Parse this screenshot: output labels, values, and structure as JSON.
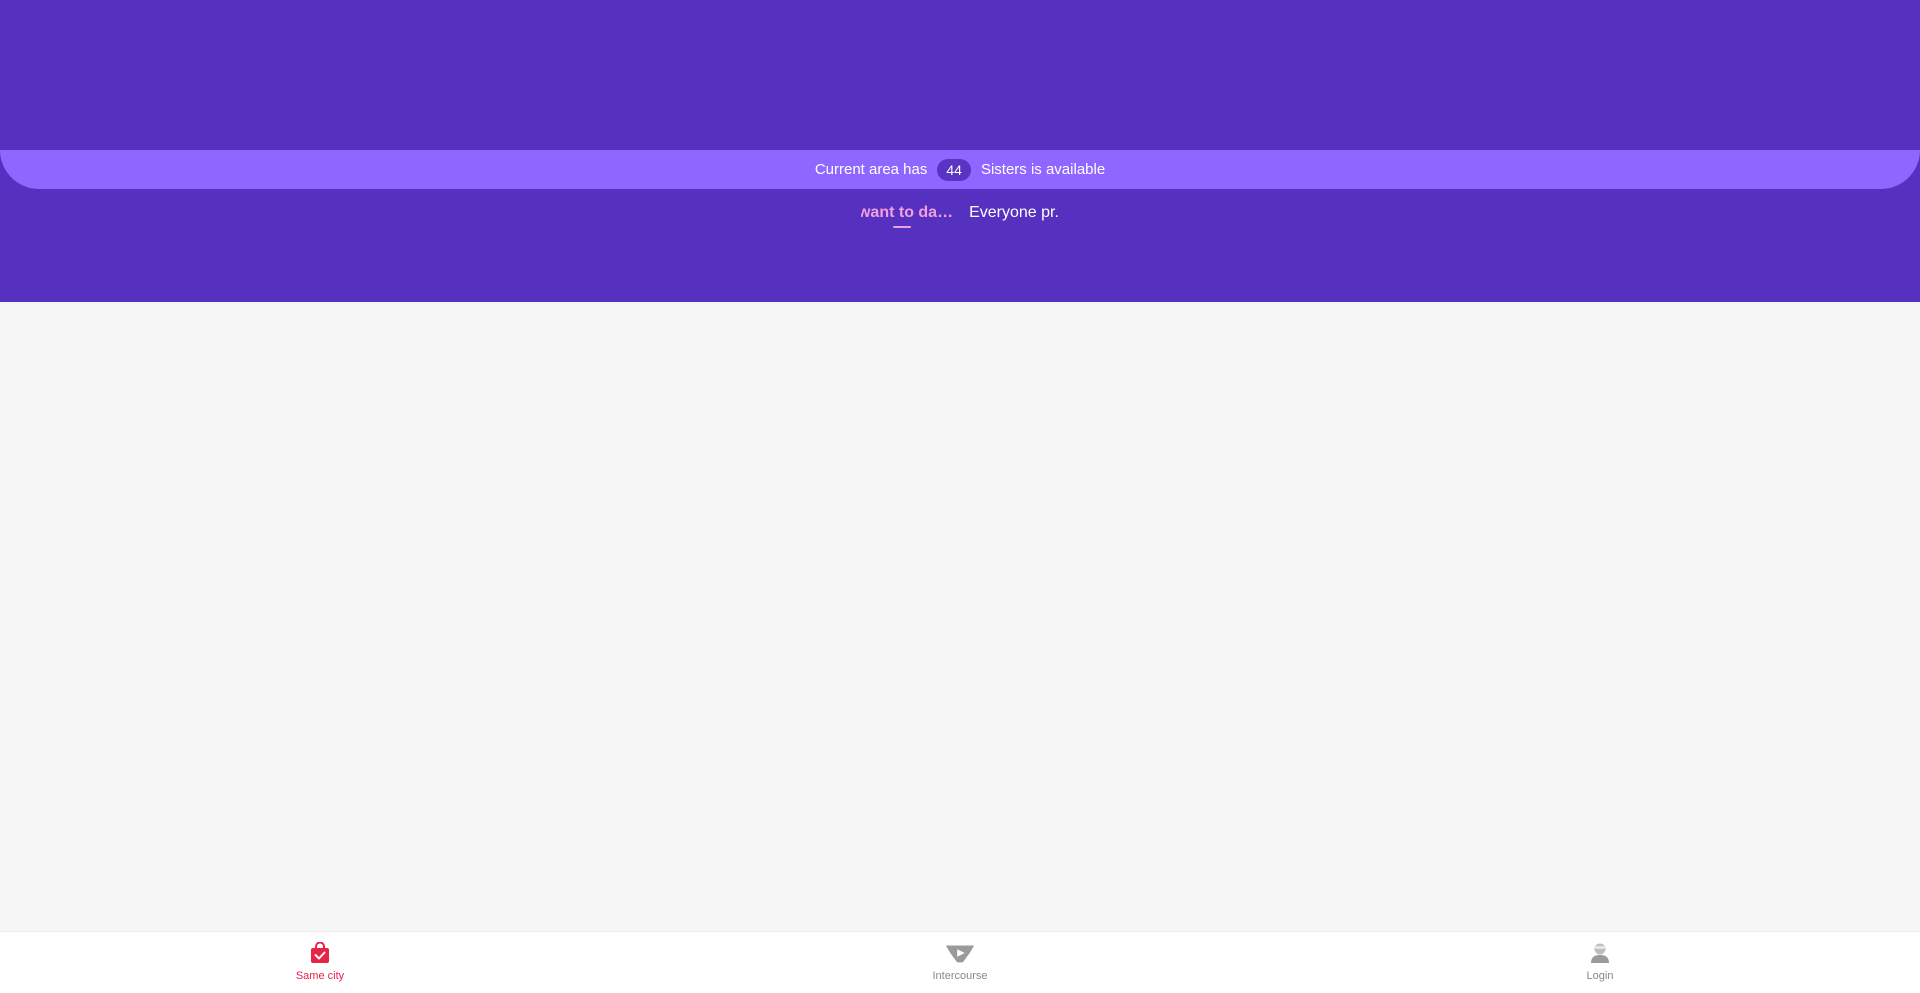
{
  "banner": {
    "prefix": "Current area has",
    "count": "44",
    "suffix": "Sisters is available"
  },
  "tabs": [
    {
      "label": "want to da…",
      "active": true
    },
    {
      "label": "Everyone pr.",
      "active": false
    }
  ],
  "bottom_nav": {
    "items": [
      {
        "label": "Same city",
        "icon": "shopping-bag-check-icon",
        "active": true
      },
      {
        "label": "Intercourse",
        "icon": "play-badge-icon",
        "active": false
      },
      {
        "label": "Login",
        "icon": "user-icon",
        "active": false
      }
    ]
  },
  "colors": {
    "header": "#5631c0",
    "banner": "#8f66ff",
    "badge": "#5a32c4",
    "active_tab": "#f0a0e0",
    "active_nav": "#e8234a",
    "inactive_nav": "#888888",
    "background": "#f6f6f6"
  }
}
